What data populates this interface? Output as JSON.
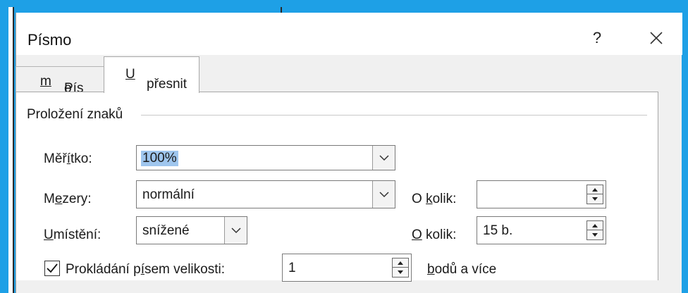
{
  "dialog": {
    "title": "Písmo",
    "help_label": "?",
    "accent_color": "#1ea0e6"
  },
  "tabs": [
    {
      "pre": "Pís",
      "key": "m",
      "post": "o",
      "active": false
    },
    {
      "pre": "",
      "key": "U",
      "post": "přesnit",
      "active": true
    }
  ],
  "group": {
    "title": "Proložení znaků"
  },
  "fields": {
    "scale": {
      "pre": "Měř",
      "key": "í",
      "post": "tko:",
      "value": "100%"
    },
    "spacing": {
      "pre": "M",
      "key": "e",
      "post": "zery:",
      "value": "normální"
    },
    "spacing_by": {
      "pre": "O ",
      "key": "k",
      "post": "olik:",
      "value": ""
    },
    "position": {
      "pre": "",
      "key": "U",
      "post": "místění:",
      "value": "snížené"
    },
    "position_by": {
      "pre": "",
      "key": "O",
      "post": " kolik:",
      "value": "15 b."
    },
    "kerning": {
      "pre": "Prokládání p",
      "key": "í",
      "post": "sem velikosti:",
      "checked": true,
      "value": "1"
    },
    "kerning_suffix": {
      "pre": "",
      "key": "b",
      "post": "odů a více"
    }
  },
  "icons": [
    "close-icon",
    "chevron-down-icon",
    "spin-up-icon",
    "spin-down-icon",
    "check-icon"
  ]
}
